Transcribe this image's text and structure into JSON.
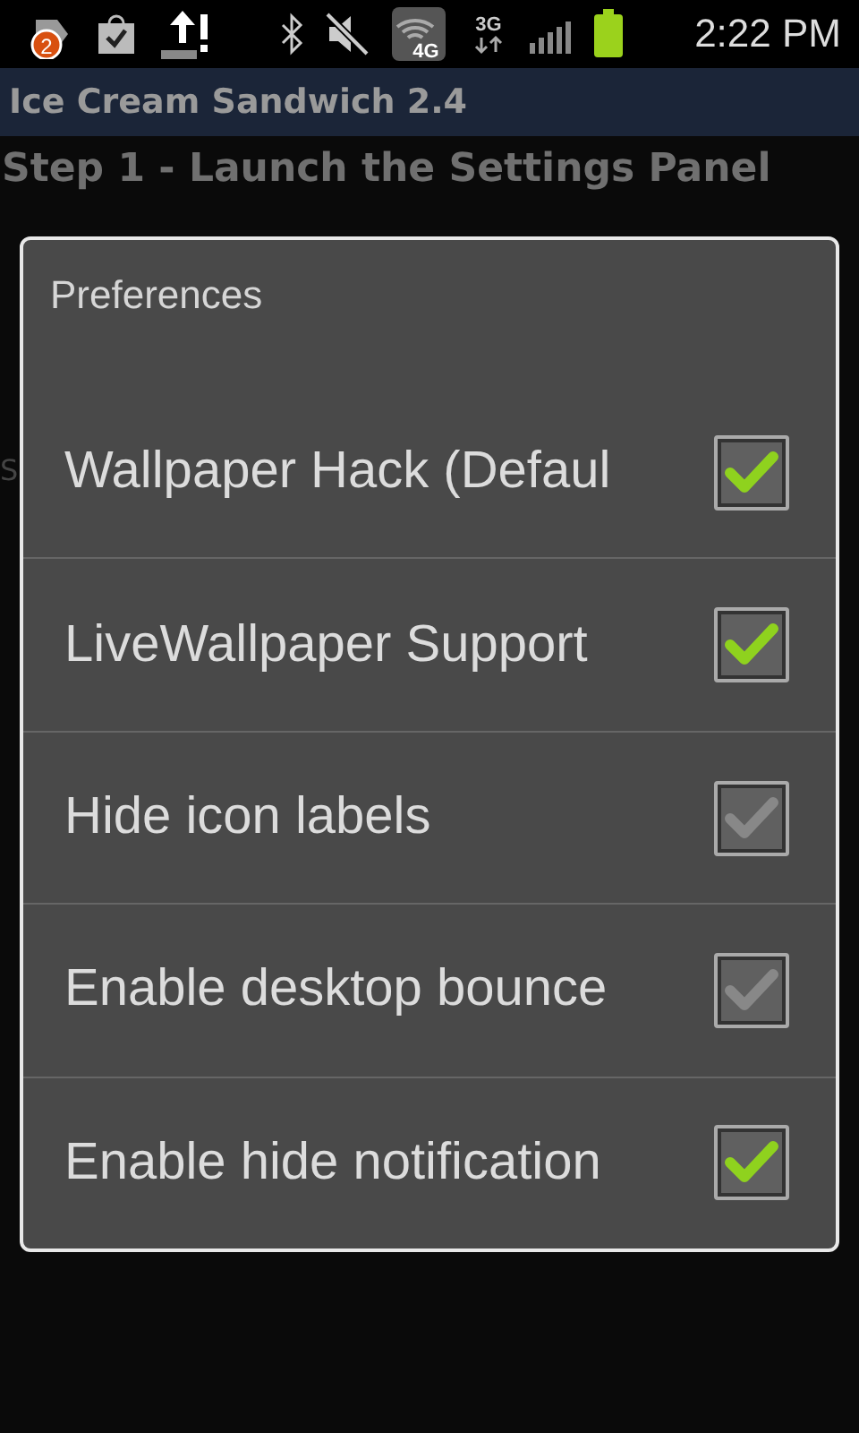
{
  "status_bar": {
    "badge": "2",
    "network_4g": "4G",
    "network_3g": "3G",
    "time": "2:22 PM"
  },
  "title_bar": {
    "title": "Ice Cream Sandwich 2.4"
  },
  "heading": "Step 1 -  Launch the Settings Panel",
  "background_fragment": "S",
  "dialog": {
    "title": "Preferences",
    "items": [
      {
        "label": "Wallpaper Hack (Defaul",
        "checked": true,
        "disabled": false
      },
      {
        "label": "LiveWallpaper Support",
        "checked": true,
        "disabled": false
      },
      {
        "label": "Hide icon labels",
        "checked": true,
        "disabled": true
      },
      {
        "label": "Enable desktop bounce",
        "checked": true,
        "disabled": true
      },
      {
        "label": "Enable hide notification",
        "checked": true,
        "disabled": false
      }
    ]
  }
}
